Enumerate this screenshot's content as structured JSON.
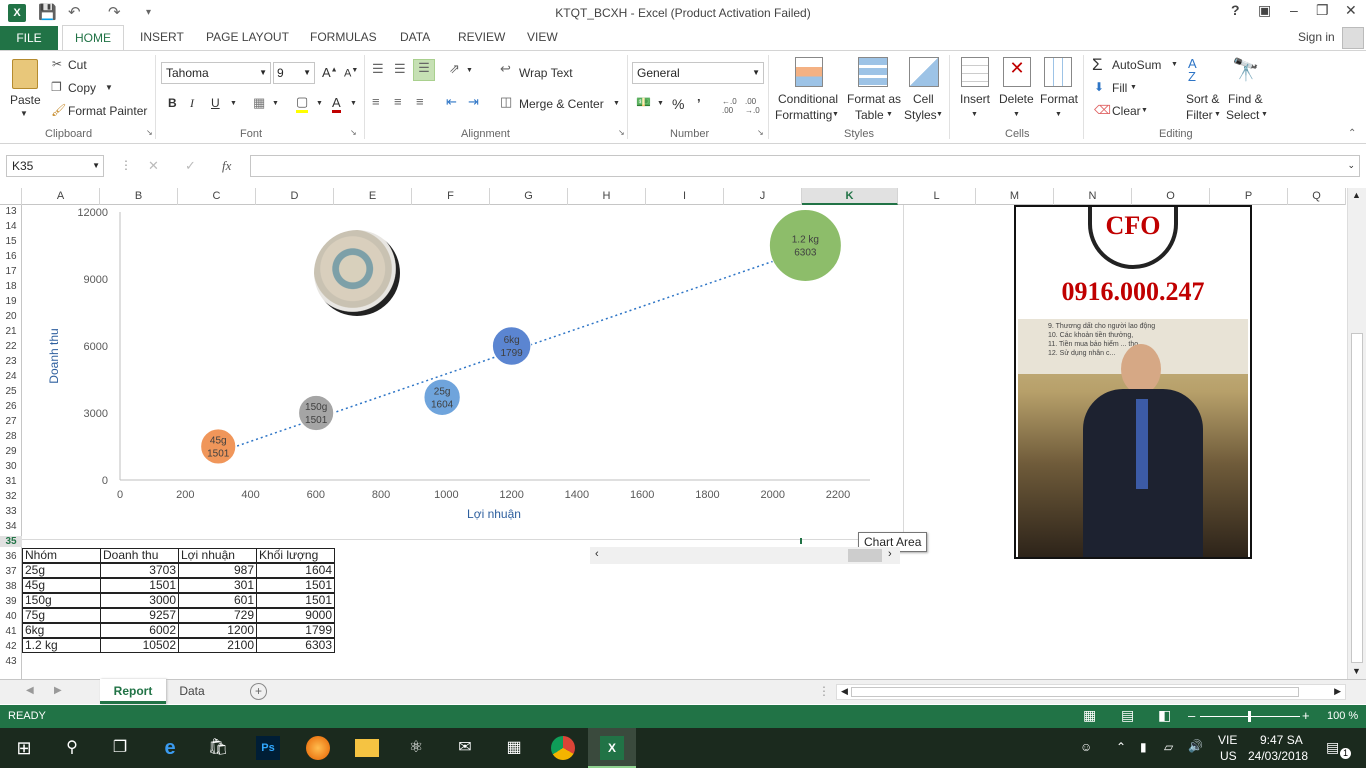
{
  "window": {
    "title": "KTQT_BCXH - Excel (Product Activation Failed)",
    "help": "?",
    "signin": "Sign in"
  },
  "ribbon_tabs": [
    "FILE",
    "HOME",
    "INSERT",
    "PAGE LAYOUT",
    "FORMULAS",
    "DATA",
    "REVIEW",
    "VIEW"
  ],
  "clipboard": {
    "paste": "Paste",
    "cut": "Cut",
    "copy": "Copy",
    "format_painter": "Format Painter",
    "label": "Clipboard"
  },
  "font": {
    "name": "Tahoma",
    "size": "9",
    "label": "Font"
  },
  "alignment": {
    "wrap": "Wrap Text",
    "merge": "Merge & Center",
    "label": "Alignment"
  },
  "number": {
    "format": "General",
    "label": "Number"
  },
  "styles": {
    "cond1": "Conditional",
    "cond2": "Formatting",
    "fmt1": "Format as",
    "fmt2": "Table",
    "cell1": "Cell",
    "cell2": "Styles",
    "label": "Styles"
  },
  "cells": {
    "insert": "Insert",
    "delete": "Delete",
    "format": "Format",
    "label": "Cells"
  },
  "editing": {
    "autosum": "AutoSum",
    "fill": "Fill",
    "clear": "Clear",
    "sort1": "Sort &",
    "sort2": "Filter",
    "find1": "Find &",
    "find2": "Select",
    "label": "Editing"
  },
  "formula_bar": {
    "name_box": "K35",
    "fx": "fx",
    "value": ""
  },
  "columns": [
    "A",
    "B",
    "C",
    "D",
    "E",
    "F",
    "G",
    "H",
    "I",
    "J",
    "K",
    "L",
    "M",
    "N",
    "O",
    "P",
    "Q"
  ],
  "rows": [
    "13",
    "14",
    "15",
    "16",
    "17",
    "18",
    "19",
    "20",
    "21",
    "22",
    "23",
    "24",
    "25",
    "26",
    "27",
    "28",
    "29",
    "30",
    "31",
    "32",
    "33",
    "34",
    "35",
    "36",
    "37",
    "38",
    "39",
    "40",
    "41",
    "42",
    "43"
  ],
  "table": {
    "headers": [
      "Nhóm",
      "Doanh thu",
      "Lợi nhuận",
      "Khối lượng"
    ],
    "rows": [
      [
        "25g",
        "3703",
        "987",
        "1604"
      ],
      [
        "45g",
        "1501",
        "301",
        "1501"
      ],
      [
        "150g",
        "3000",
        "601",
        "1501"
      ],
      [
        "75g",
        "9257",
        "729",
        "9000"
      ],
      [
        "6kg",
        "6002",
        "1200",
        "1799"
      ],
      [
        "1.2 kg",
        "10502",
        "2100",
        "6303"
      ]
    ]
  },
  "chart_data": {
    "type": "scatter",
    "title": "",
    "xlabel": "Lợi nhuận",
    "ylabel": "Doanh thu",
    "xlim": [
      0,
      2200
    ],
    "ylim": [
      0,
      12000
    ],
    "xticks": [
      "0",
      "200",
      "400",
      "600",
      "800",
      "1000",
      "1200",
      "1400",
      "1600",
      "1800",
      "2000",
      "2200"
    ],
    "yticks": [
      "0",
      "3000",
      "6000",
      "9000",
      "12000"
    ],
    "series": [
      {
        "label": "45g",
        "x": 301,
        "y": 1501,
        "size": 1501,
        "color": "#f0965a"
      },
      {
        "label": "150g",
        "x": 601,
        "y": 3000,
        "size": 1501,
        "color": "#a5a5a5"
      },
      {
        "label": "25g",
        "x": 987,
        "y": 3703,
        "size": 1604,
        "color": "#6fa4dc"
      },
      {
        "label": "6kg",
        "x": 1200,
        "y": 6002,
        "size": 1799,
        "color": "#5b85d1"
      },
      {
        "label": "1.2 kg",
        "x": 2100,
        "y": 10502,
        "size": 6303,
        "color": "#8dbd6a"
      }
    ],
    "trendline": {
      "style": "dotted",
      "color": "#2e75c6"
    },
    "tooltip": "Chart Area"
  },
  "ad": {
    "phone": "0916.000.247",
    "logo_text": "CFO",
    "slide_lines": [
      "9. Thương dất cho người lao động",
      "10. Các khoản tiền thưởng,",
      "11. Tiền mua bảo hiểm ... thọ",
      "12. Sử dụng nhân c..."
    ]
  },
  "sheet_tabs": [
    "Report",
    "Data"
  ],
  "status": {
    "ready": "READY",
    "zoom": "100 %"
  },
  "taskbar": {
    "lang1": "VIE",
    "lang2": "US",
    "time": "9:47 SA",
    "date": "24/03/2018",
    "notif": "1"
  },
  "colors": {
    "excel_green": "#217346",
    "phone_red": "#c00000"
  }
}
